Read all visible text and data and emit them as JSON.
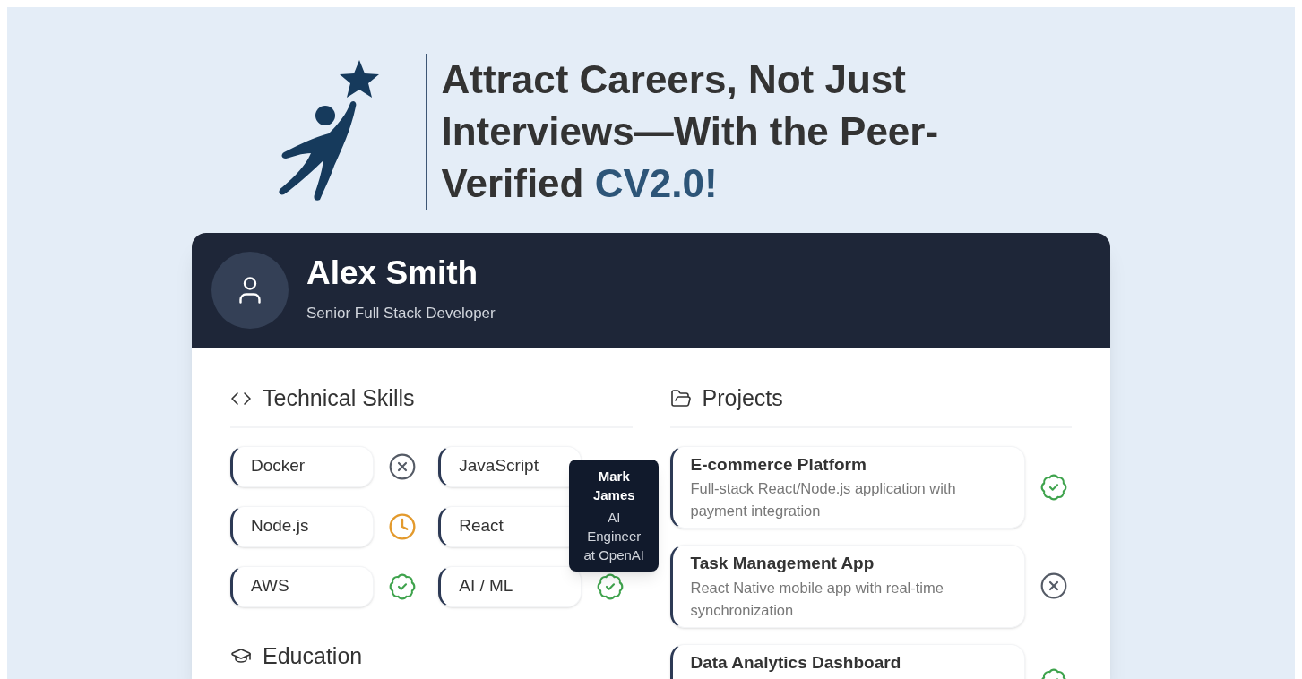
{
  "hero": {
    "headline": "Attract Careers, Not Just Interviews—With the Peer-Verified",
    "headline_highlight": "CV2.0!"
  },
  "profile": {
    "name": "Alex Smith",
    "role": "Senior Full Stack Developer"
  },
  "skills": {
    "title": "Technical Skills",
    "items": [
      {
        "label": "Docker",
        "kind": "rejected"
      },
      {
        "label": "JavaScript"
      },
      {
        "label": "Node.js",
        "kind": "pending"
      },
      {
        "label": "React"
      },
      {
        "label": "AWS",
        "kind": "verified"
      },
      {
        "label": "AI / ML",
        "kind": "verified",
        "tooltip": {
          "name": "Mark James",
          "role": "AI Engineer at OpenAI"
        }
      }
    ]
  },
  "projects": {
    "title": "Projects",
    "items": [
      {
        "title": "E-commerce Platform",
        "description": "Full-stack React/Node.js application with payment integration",
        "kind": "verified"
      },
      {
        "title": "Task Management App",
        "description": "React Native mobile app with real-time synchronization",
        "kind": "rejected"
      },
      {
        "title": "Data Analytics Dashboard",
        "kind": "verified"
      }
    ]
  },
  "education": {
    "title": "Education"
  }
}
